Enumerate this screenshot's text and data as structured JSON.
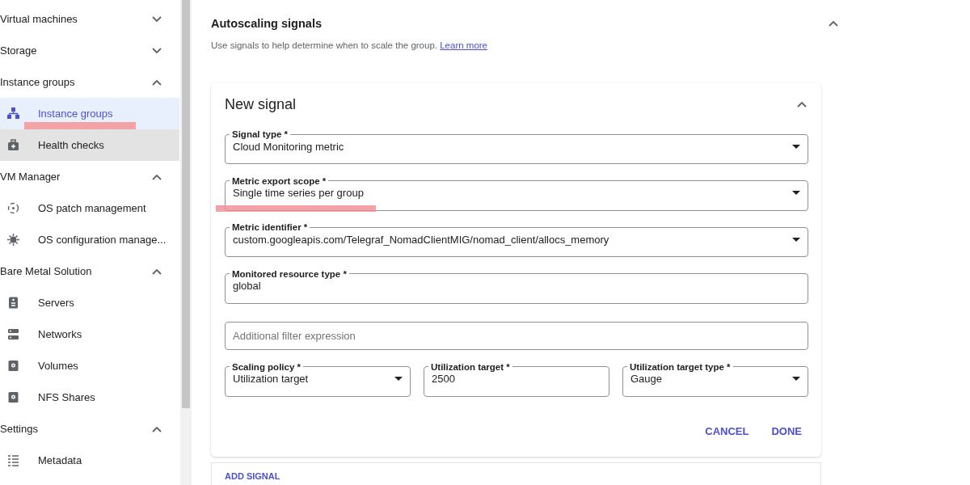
{
  "sidebar": {
    "sections": [
      {
        "title": "Virtual machines",
        "expanded": false
      },
      {
        "title": "Storage",
        "expanded": false
      },
      {
        "title": "Instance groups",
        "expanded": true,
        "items": [
          {
            "label": "Instance groups",
            "kind": "groups",
            "selected": true,
            "hovered": false,
            "annotated": true
          },
          {
            "label": "Health checks",
            "kind": "health",
            "selected": false,
            "hovered": true,
            "annotated": false
          }
        ]
      },
      {
        "title": "VM Manager",
        "expanded": true,
        "items": [
          {
            "label": "OS patch management",
            "kind": "patch",
            "selected": false,
            "hovered": false,
            "annotated": false
          },
          {
            "label": "OS configuration manage...",
            "kind": "config",
            "selected": false,
            "hovered": false,
            "annotated": false
          }
        ]
      },
      {
        "title": "Bare Metal Solution",
        "expanded": true,
        "items": [
          {
            "label": "Servers",
            "kind": "server",
            "selected": false,
            "hovered": false,
            "annotated": false
          },
          {
            "label": "Networks",
            "kind": "network",
            "selected": false,
            "hovered": false,
            "annotated": false
          },
          {
            "label": "Volumes",
            "kind": "volume",
            "selected": false,
            "hovered": false,
            "annotated": false
          },
          {
            "label": "NFS Shares",
            "kind": "volume",
            "selected": false,
            "hovered": false,
            "annotated": false
          }
        ]
      },
      {
        "title": "Settings",
        "expanded": true,
        "items": [
          {
            "label": "Metadata",
            "kind": "list",
            "selected": false,
            "hovered": false,
            "annotated": false
          }
        ]
      }
    ]
  },
  "section": {
    "title": "Autoscaling signals",
    "expanded": true,
    "description": "Use signals to help determine when to scale the group.",
    "link": "Learn more",
    "card": {
      "title": "New signal",
      "expanded": true,
      "fields": [
        {
          "kind": "select",
          "label": "Signal type *",
          "value": "Cloud Monitoring metric",
          "annotated": false
        },
        {
          "kind": "select",
          "label": "Metric export scope *",
          "value": "Single time series per group",
          "annotated": true
        },
        {
          "kind": "select",
          "label": "Metric identifier *",
          "value": "custom.googleapis.com/Telegraf_NomadClientMIG/nomad_client/allocs_memory",
          "annotated": false
        },
        {
          "kind": "text",
          "label": "Monitored resource type *",
          "value": "global",
          "annotated": false
        },
        {
          "kind": "text",
          "placeholder": "Additional filter expression",
          "annotated": false
        }
      ],
      "row_fields": [
        {
          "kind": "select",
          "label": "Scaling policy *",
          "value": "Utilization target",
          "annotated": false
        },
        {
          "kind": "text",
          "label": "Utilization target *",
          "value": "2500",
          "annotated": false
        },
        {
          "kind": "select",
          "label": "Utilization target type *",
          "value": "Gauge",
          "annotated": false
        }
      ],
      "buttons": [
        "CANCEL",
        "DONE"
      ]
    },
    "add_button": "ADD SIGNAL"
  }
}
